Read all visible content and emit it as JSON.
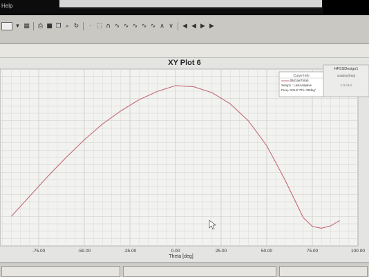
{
  "app": {
    "menu_help": "Help"
  },
  "toolbar": {
    "icons": [
      "dropdown-icon",
      "grid-icon",
      "print-icon",
      "save-icon",
      "copy-icon",
      "zoom-icon",
      "rotate-icon",
      "point-icon",
      "fit-icon",
      "arc-icon",
      "wave1-icon",
      "wave2-icon",
      "wave3-icon",
      "wave4-icon",
      "wave5-icon",
      "marker-up-icon",
      "marker-down-icon",
      "first-icon",
      "prev-icon",
      "play-icon",
      "next-icon"
    ]
  },
  "plot": {
    "title": "XY Plot 6",
    "design_label": "HFSSDesign1"
  },
  "legend": {
    "header": "Curve Info",
    "col2": "solution(freq)",
    "line1": "dB(GainTotal)",
    "line2": "Setup1 : LastAdaptive",
    "line3": "Freq='1GHz' Phi='90deg'",
    "value_text": "1.0 GHz"
  },
  "chart_data": {
    "type": "line",
    "title": "XY Plot 6",
    "xlabel": "Theta [deg]",
    "ylabel": "",
    "xlim": [
      -100,
      100
    ],
    "ylim": [
      -25,
      5
    ],
    "grid": true,
    "legend_position": "top-right",
    "x_ticks": [
      "-75.00",
      "-50.00",
      "-25.00",
      "0.00",
      "25.00",
      "50.00",
      "75.00",
      "100.00"
    ],
    "x_tick_values": [
      -75,
      -50,
      -25,
      0,
      25,
      50,
      75,
      100
    ],
    "series": [
      {
        "name": "dB(GainTotal)",
        "color": "#c26a74",
        "x": [
          -90,
          -80,
          -70,
          -60,
          -50,
          -40,
          -30,
          -20,
          -10,
          0,
          10,
          20,
          30,
          40,
          50,
          60,
          70,
          75,
          80,
          85,
          90
        ],
        "y": [
          -20.0,
          -16.6,
          -13.2,
          -10.0,
          -7.0,
          -4.3,
          -2.1,
          -0.2,
          1.2,
          2.2,
          2.0,
          1.0,
          -0.9,
          -3.8,
          -8.0,
          -13.8,
          -20.2,
          -21.7,
          -22.0,
          -21.6,
          -20.7
        ]
      }
    ]
  }
}
